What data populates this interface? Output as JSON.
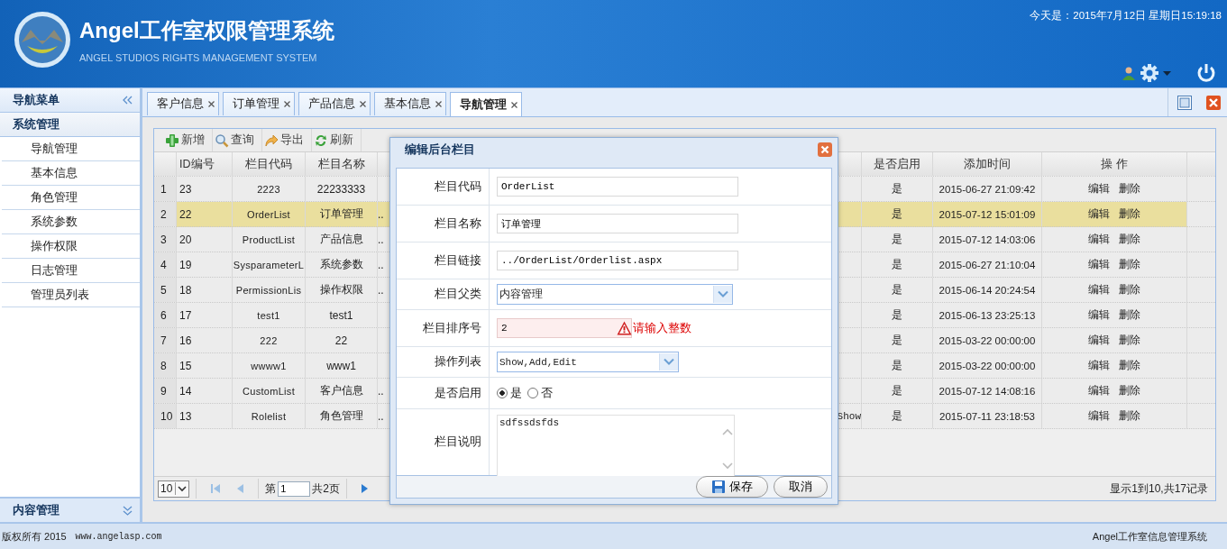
{
  "header": {
    "title": "Angel工作室权限管理系统",
    "subtitle": "ANGEL STUDIOS RIGHTS MANAGEMENT SYSTEM",
    "datetime": "今天是：2015年7月12日 星期日15:19:18"
  },
  "sidebar": {
    "title": "导航菜单",
    "sections": [
      {
        "title": "系统管理",
        "expanded": true,
        "items": [
          {
            "label": "导航管理",
            "selected": false
          },
          {
            "label": "基本信息",
            "selected": false
          },
          {
            "label": "角色管理",
            "selected": false
          },
          {
            "label": "系统参数",
            "selected": false
          },
          {
            "label": "操作权限",
            "selected": false
          },
          {
            "label": "日志管理",
            "selected": false
          },
          {
            "label": "管理员列表",
            "selected": false
          }
        ]
      },
      {
        "title": "内容管理",
        "expanded": false
      }
    ]
  },
  "tabs": [
    {
      "label": "客户信息",
      "selected": false
    },
    {
      "label": "订单管理",
      "selected": false
    },
    {
      "label": "产品信息",
      "selected": false
    },
    {
      "label": "基本信息",
      "selected": false
    },
    {
      "label": "导航管理",
      "selected": true
    }
  ],
  "toolbar": [
    {
      "label": "新增",
      "kind": "add"
    },
    {
      "label": "查询",
      "kind": "search"
    },
    {
      "label": "导出",
      "kind": "export"
    },
    {
      "label": "刷新",
      "kind": "refresh"
    }
  ],
  "grid": {
    "columns": [
      "ID编号",
      "栏目代码",
      "栏目名称",
      "是否启用",
      "添加时间",
      "操 作"
    ],
    "rows": [
      {
        "number": "1",
        "id": "23",
        "code": "2223",
        "name": "22233333",
        "column_4": "",
        "column_5": "",
        "enabled": "是",
        "added": "2015-06-27 21:09:42",
        "actions": [
          "编辑",
          "删除"
        ],
        "selected": false
      },
      {
        "number": "2",
        "id": "22",
        "code": "OrderList",
        "name": "订单管理",
        "column_4": "..",
        "column_5": "",
        "enabled": "是",
        "added": "2015-07-12 15:01:09",
        "actions": [
          "编辑",
          "删除"
        ],
        "selected": true
      },
      {
        "number": "3",
        "id": "20",
        "code": "ProductList",
        "name": "产品信息",
        "column_4": "..",
        "column_5": "",
        "enabled": "是",
        "added": "2015-07-12 14:03:06",
        "actions": [
          "编辑",
          "删除"
        ],
        "selected": false
      },
      {
        "number": "4",
        "id": "19",
        "code": "SysparameterL",
        "name": "系统参数",
        "column_4": "..",
        "column_5": "",
        "enabled": "是",
        "added": "2015-06-27 21:10:04",
        "actions": [
          "编辑",
          "删除"
        ],
        "selected": false
      },
      {
        "number": "5",
        "id": "18",
        "code": "PermissionLis",
        "name": "操作权限",
        "column_4": "..",
        "column_5": "",
        "enabled": "是",
        "added": "2015-06-14 20:24:54",
        "actions": [
          "编辑",
          "删除"
        ],
        "selected": false
      },
      {
        "number": "6",
        "id": "17",
        "code": "test1",
        "name": "test1",
        "column_4": "",
        "column_5": "",
        "enabled": "是",
        "added": "2015-06-13 23:25:13",
        "actions": [
          "编辑",
          "删除"
        ],
        "selected": false
      },
      {
        "number": "7",
        "id": "16",
        "code": "222",
        "name": "22",
        "column_4": "",
        "column_5": "",
        "enabled": "是",
        "added": "2015-03-22 00:00:00",
        "actions": [
          "编辑",
          "删除"
        ],
        "selected": false
      },
      {
        "number": "8",
        "id": "15",
        "code": "wwww1",
        "name": "www1",
        "column_4": "",
        "column_5": "",
        "enabled": "是",
        "added": "2015-03-22 00:00:00",
        "actions": [
          "编辑",
          "删除"
        ],
        "selected": false
      },
      {
        "number": "9",
        "id": "14",
        "code": "CustomList",
        "name": "客户信息",
        "column_4": "..",
        "column_5": "",
        "enabled": "是",
        "added": "2015-07-12 14:08:16",
        "actions": [
          "编辑",
          "删除"
        ],
        "selected": false
      },
      {
        "number": "10",
        "id": "13",
        "code": "Rolelist",
        "name": "角色管理",
        "column_4": "..",
        "column_5": "Show",
        "enabled": "是",
        "added": "2015-07-11 23:18:53",
        "actions": [
          "编辑",
          "删除"
        ],
        "selected": false
      }
    ]
  },
  "pager": {
    "page_size": "10",
    "page_label": "第",
    "page": "1",
    "total_pages": "共2页",
    "summary": "显示1到10,共17记录"
  },
  "dialog": {
    "title": "编辑后台栏目",
    "fields": [
      {
        "kind": "text",
        "label": "栏目代码",
        "value": "OrderList"
      },
      {
        "kind": "text",
        "label": "栏目名称",
        "value": "订单管理"
      },
      {
        "kind": "text",
        "label": "栏目链接",
        "value": "../OrderList/Orderlist.aspx"
      },
      {
        "kind": "select",
        "label": "栏目父类",
        "value": "内容管理"
      },
      {
        "kind": "text",
        "label": "栏目排序号",
        "value": "2",
        "invalid": true,
        "error": "请输入整数"
      },
      {
        "kind": "select",
        "label": "操作列表",
        "value": "Show,Add,Edit"
      },
      {
        "kind": "radio",
        "label": "是否启用",
        "options": [
          {
            "label": "是",
            "selected": true
          },
          {
            "label": "否",
            "selected": false
          }
        ]
      },
      {
        "kind": "textarea",
        "label": "栏目说明",
        "value": "sdfssdsfds"
      }
    ],
    "buttons": [
      {
        "label": "保存",
        "kind": "save"
      },
      {
        "label": "取消",
        "kind": "cancel"
      }
    ]
  },
  "footer": {
    "copyright": "版权所有 2015",
    "url": "www.angelasp.com",
    "product": "Angel工作室信息管理系统"
  }
}
